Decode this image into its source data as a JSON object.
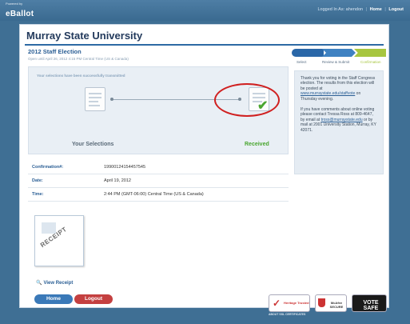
{
  "brand": {
    "powered": "Powered by",
    "name": "eBallot"
  },
  "user_bar": {
    "logged_in": "Logged In As: ahendon",
    "home": "Home",
    "logout": "Logout"
  },
  "university": "Murray State University",
  "election": {
    "title": "2012 Staff Election",
    "open_until": "Open until April 26, 2012 4:15 PM Central Time (US & Canada)"
  },
  "steps": [
    "Select",
    "Review & Submit",
    "Confirmation"
  ],
  "transmit": {
    "message": "Your selections have been successfully transmitted",
    "from_label": "Your Selections",
    "to_label": "Received"
  },
  "sidebar": {
    "para1": "Thank you for voting in the Staff Congress election. The results from this election will be posted at",
    "link1": "www.murraystate.edu/staffvote",
    "para1_end": "on Thursday evening.",
    "para2": "If you have comments about online voting please contact Tressa Ross at 809-4647, by email at",
    "link2": "tross@murraystate.edu",
    "para2_end": "or by mail at 2001 University Station, Murray, KY 42071."
  },
  "details": [
    {
      "label": "Confirmation#:",
      "value": "19900124154457545"
    },
    {
      "label": "Date:",
      "value": "April 19, 2012"
    },
    {
      "label": "Time:",
      "value": "2:44 PM (GMT-06:00) Central Time (US & Canada)"
    }
  ],
  "receipt": {
    "stamp": "RECEIPT",
    "view_label": "View Receipt"
  },
  "buttons": {
    "home": "Home",
    "logout": "Logout"
  },
  "badges": {
    "heritage": "Heritage Trusted",
    "mcafee": "McAfee SECURE",
    "vote_safe": "VOTE SAFE",
    "about_ssl": "ABOUT SSL CERTIFICATES"
  }
}
